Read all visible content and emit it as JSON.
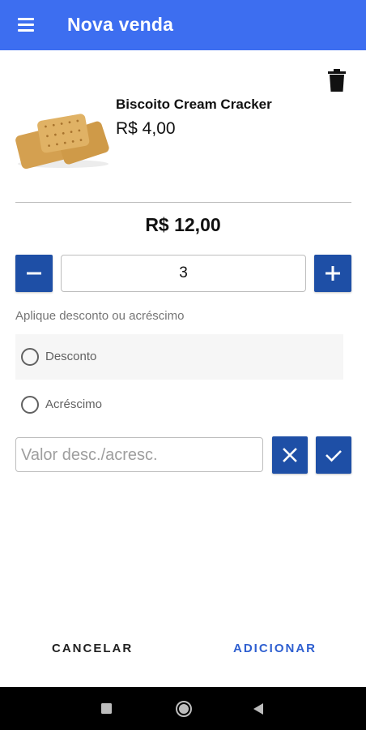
{
  "appbar": {
    "title": "Nova venda",
    "color": "#3d6ef0"
  },
  "product": {
    "name": "Biscoito Cream Cracker",
    "price": "R$ 4,00",
    "image_icon": "cream-cracker-biscuit"
  },
  "total": "R$ 12,00",
  "quantity": {
    "value": "3",
    "decrement_icon": "minus-icon",
    "increment_icon": "plus-icon"
  },
  "adjustment": {
    "hint": "Aplique desconto ou acréscimo",
    "options": [
      {
        "label": "Desconto",
        "selected": false
      },
      {
        "label": "Acréscimo",
        "selected": false
      }
    ],
    "value_placeholder": "Valor desc./acresc.",
    "clear_icon": "close-icon",
    "confirm_icon": "check-icon"
  },
  "footer": {
    "cancel_label": "CANCELAR",
    "add_label": "ADICIONAR"
  },
  "colors": {
    "accent": "#1e4fa6",
    "add_text": "#2e5fd0"
  }
}
